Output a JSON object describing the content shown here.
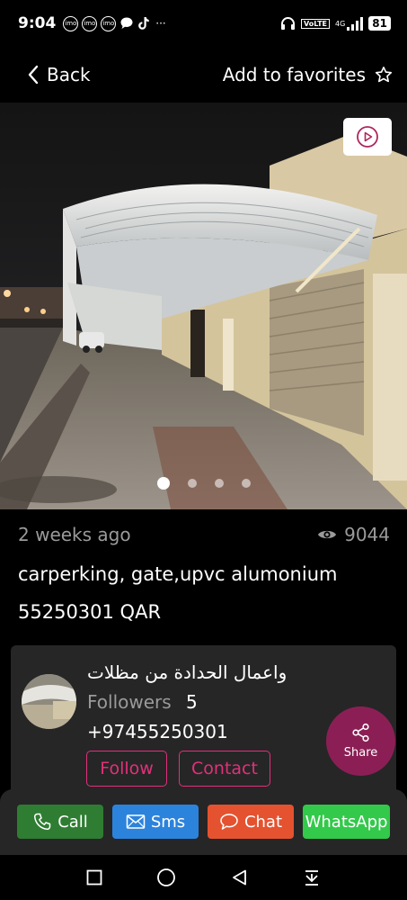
{
  "status": {
    "time": "9:04",
    "notif_icons": [
      "imo",
      "imo",
      "imo"
    ],
    "more": "···",
    "network": "4G",
    "volte": "VoLTE",
    "battery": "81"
  },
  "nav": {
    "back_label": "Back",
    "favorite_label": "Add to favorites"
  },
  "listing": {
    "posted": "2 weeks ago",
    "views": "9044",
    "title": "carperking, gate,upvc alumonium",
    "price": "55250301 QAR",
    "gallery_dots": 4,
    "active_image": 1
  },
  "seller": {
    "name": "واعمال الحدادة من مظلات",
    "followers_label": "Followers",
    "followers_count": "5",
    "phone": "+97455250301",
    "follow_label": "Follow",
    "contact_label": "Contact"
  },
  "share_label": "Share",
  "actions": {
    "call": "Call",
    "sms": "Sms",
    "chat": "Chat",
    "whatsapp": "WhatsApp"
  },
  "colors": {
    "accent": "#e2307a",
    "share_bg": "#8b1f55",
    "call": "#2f7d32",
    "sms": "#2c83dc",
    "chat": "#e5522f",
    "whatsapp": "#33c94a"
  }
}
